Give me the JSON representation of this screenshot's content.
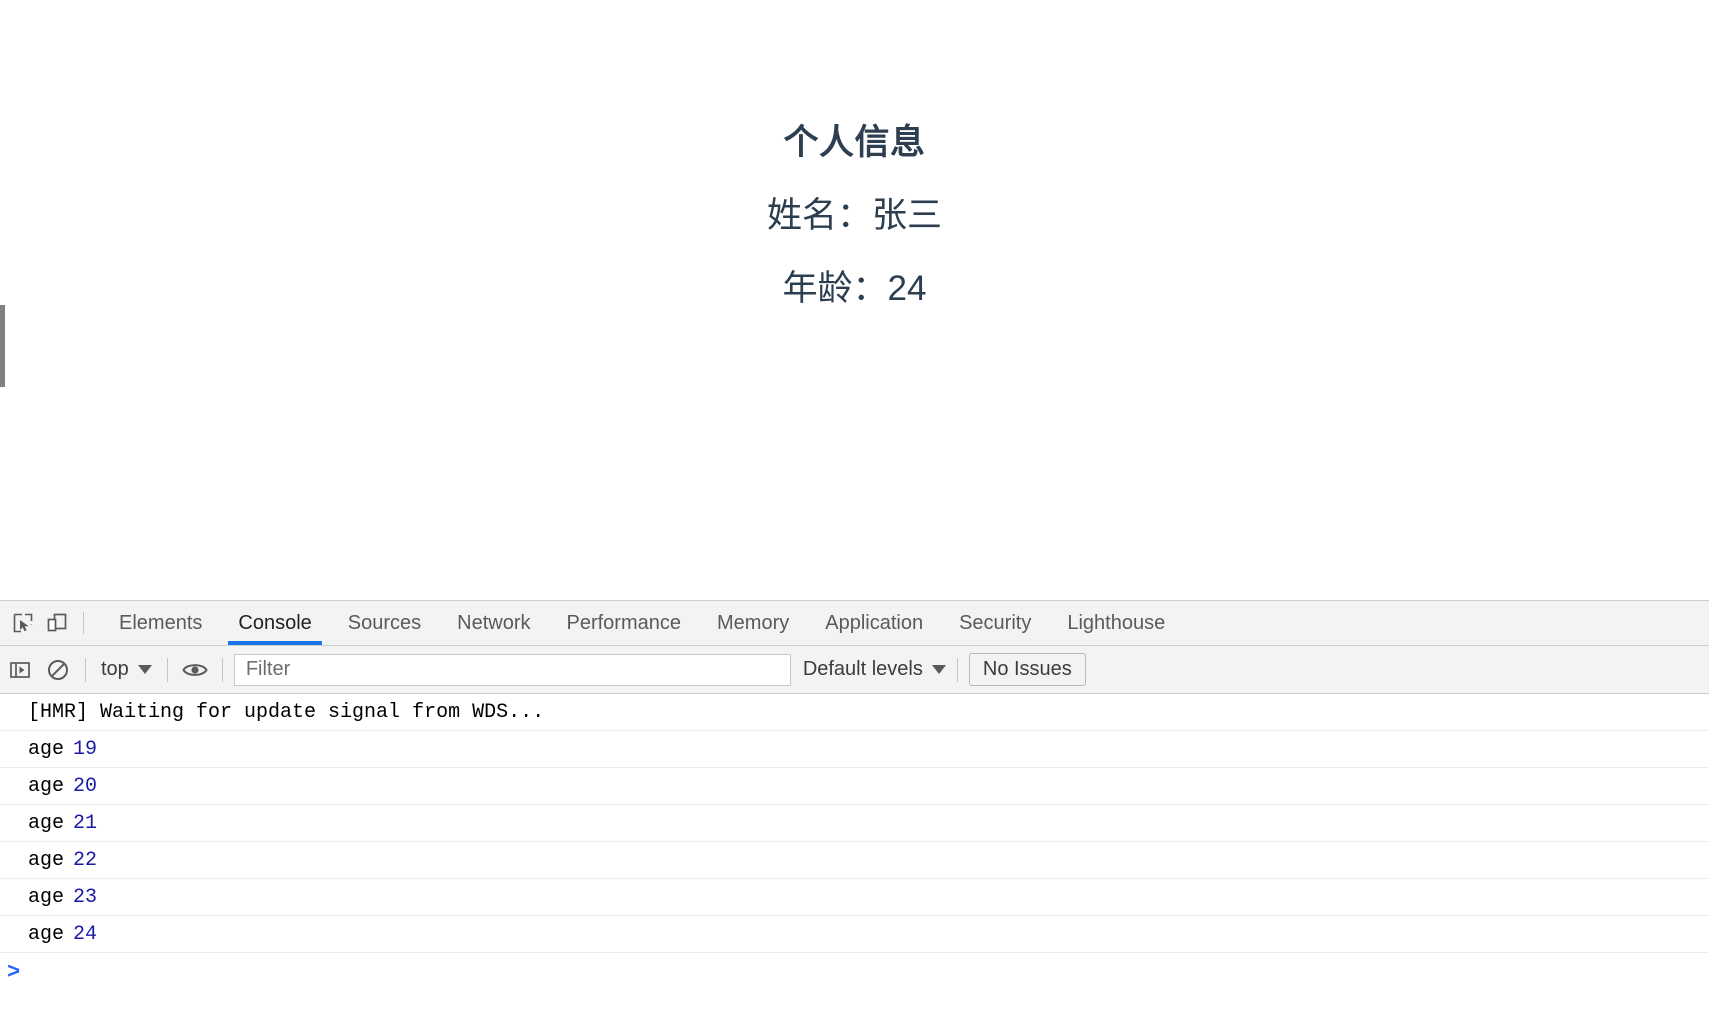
{
  "page": {
    "title": "个人信息",
    "name_line": "姓名：张三",
    "age_line": "年龄：24",
    "text_color": "#2c3e50"
  },
  "devtools": {
    "icons": {
      "inspect": "inspect-element-icon",
      "device": "device-toolbar-icon",
      "sidebar": "console-sidebar-icon",
      "clear": "clear-console-icon",
      "eye": "live-expression-eye-icon"
    },
    "tabs": [
      {
        "label": "Elements",
        "active": false
      },
      {
        "label": "Console",
        "active": true
      },
      {
        "label": "Sources",
        "active": false
      },
      {
        "label": "Network",
        "active": false
      },
      {
        "label": "Performance",
        "active": false
      },
      {
        "label": "Memory",
        "active": false
      },
      {
        "label": "Application",
        "active": false
      },
      {
        "label": "Security",
        "active": false
      },
      {
        "label": "Lighthouse",
        "active": false
      }
    ],
    "active_tab_color": "#1a73e8",
    "toolbar": {
      "context": "top",
      "filter_value": "",
      "filter_placeholder": "Filter",
      "levels": "Default levels",
      "issues": "No Issues"
    },
    "console_rows": [
      {
        "text": "[HMR] Waiting for update signal from WDS...",
        "value": ""
      },
      {
        "text": "age",
        "value": "19"
      },
      {
        "text": "age",
        "value": "20"
      },
      {
        "text": "age",
        "value": "21"
      },
      {
        "text": "age",
        "value": "22"
      },
      {
        "text": "age",
        "value": "23"
      },
      {
        "text": "age",
        "value": "24"
      }
    ],
    "prompt_symbol": ">",
    "number_color": "#1a1aa6",
    "prompt_color": "#2962ff"
  }
}
